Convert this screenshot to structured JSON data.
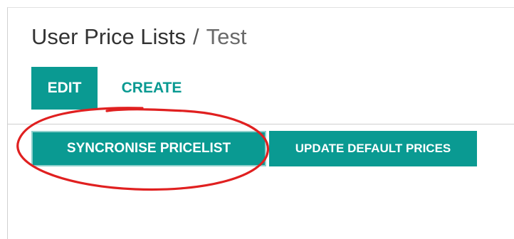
{
  "breadcrumb": {
    "parent": "User Price Lists",
    "separator": "/",
    "current": "Test"
  },
  "control_panel": {
    "edit_label": "EDIT",
    "create_label": "CREATE"
  },
  "header_actions": {
    "sync_label": "SYNCRONISE PRICELIST",
    "update_label": "UPDATE DEFAULT PRICES"
  },
  "colors": {
    "primary": "#0a9a92",
    "annotation": "#e02020"
  }
}
